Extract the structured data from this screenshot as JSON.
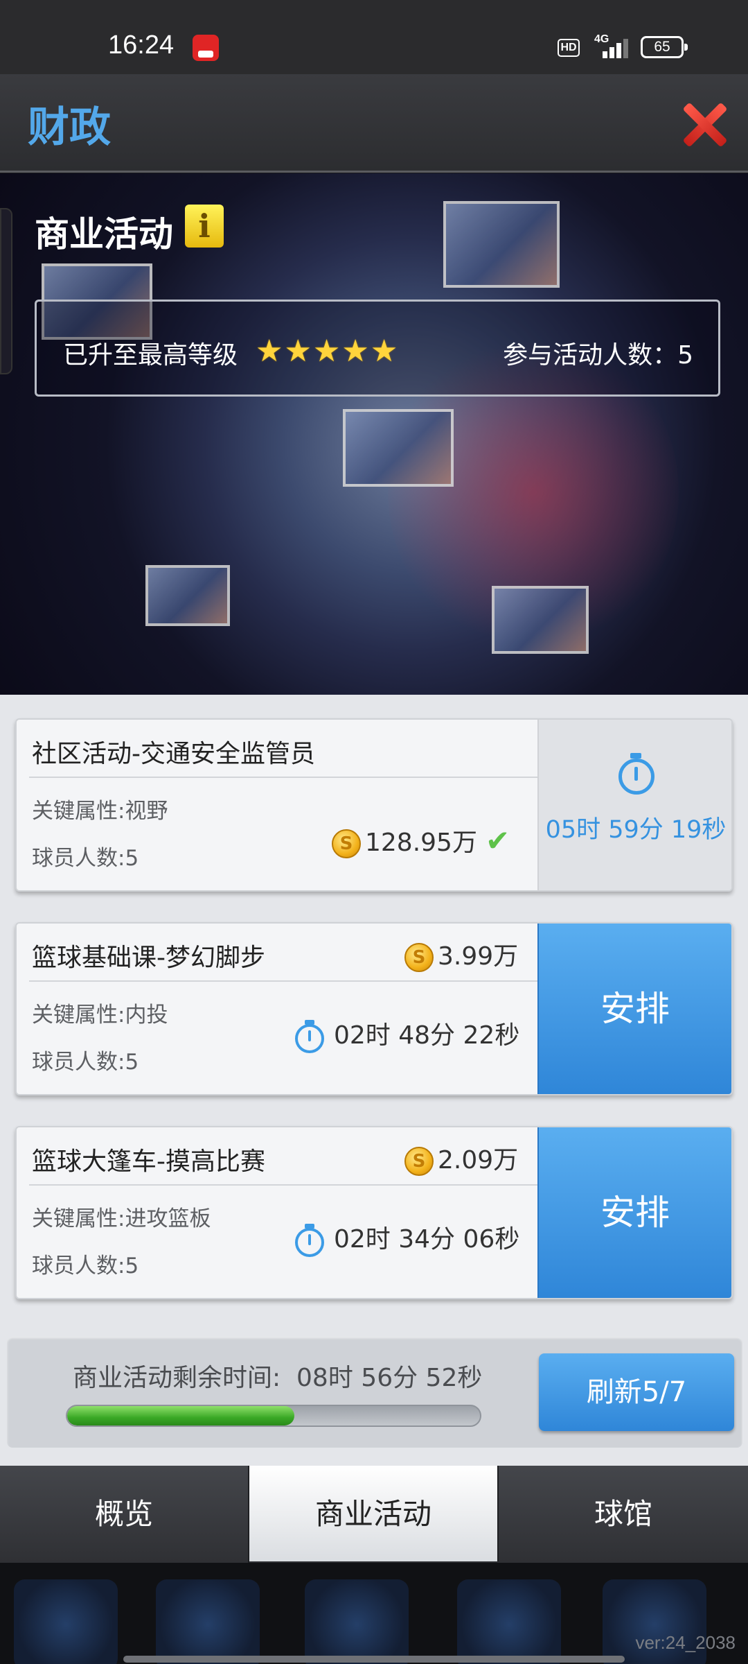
{
  "status_bar": {
    "time": "16:24",
    "hd": "HD",
    "network": "4G",
    "battery": "65"
  },
  "header": {
    "title": "财政"
  },
  "banner": {
    "section_title": "商业活动",
    "level_text": "已升至最高等级",
    "stars": 5,
    "participants": "参与活动人数：5"
  },
  "activities": [
    {
      "name": "社区活动-交通安全监管员",
      "attribute": "关键属性:视野",
      "players": "球员人数:5",
      "reward": "128.95万",
      "status": "running",
      "countdown": "05时 59分 19秒"
    },
    {
      "name": "篮球基础课-梦幻脚步",
      "attribute": "关键属性:内投",
      "players": "球员人数:5",
      "reward": "3.99万",
      "duration": "02时 48分 22秒",
      "button": "安排"
    },
    {
      "name": "篮球大篷车-摸高比赛",
      "attribute": "关键属性:进攻篮板",
      "players": "球员人数:5",
      "reward": "2.09万",
      "duration": "02时 34分 06秒",
      "button": "安排"
    }
  ],
  "footer": {
    "remaining_label": "商业活动剩余时间:",
    "remaining_time": "08时 56分 52秒",
    "progress_fraction": 0.55,
    "refresh_label": "刷新5/7"
  },
  "tabs": [
    "概览",
    "商业活动",
    "球馆"
  ],
  "active_tab": 1,
  "version": "ver:24_2038",
  "colors": {
    "accent": "#3b9be6",
    "title": "#53a8ea",
    "progress": "#3aa826",
    "star": "#ffd43c"
  }
}
